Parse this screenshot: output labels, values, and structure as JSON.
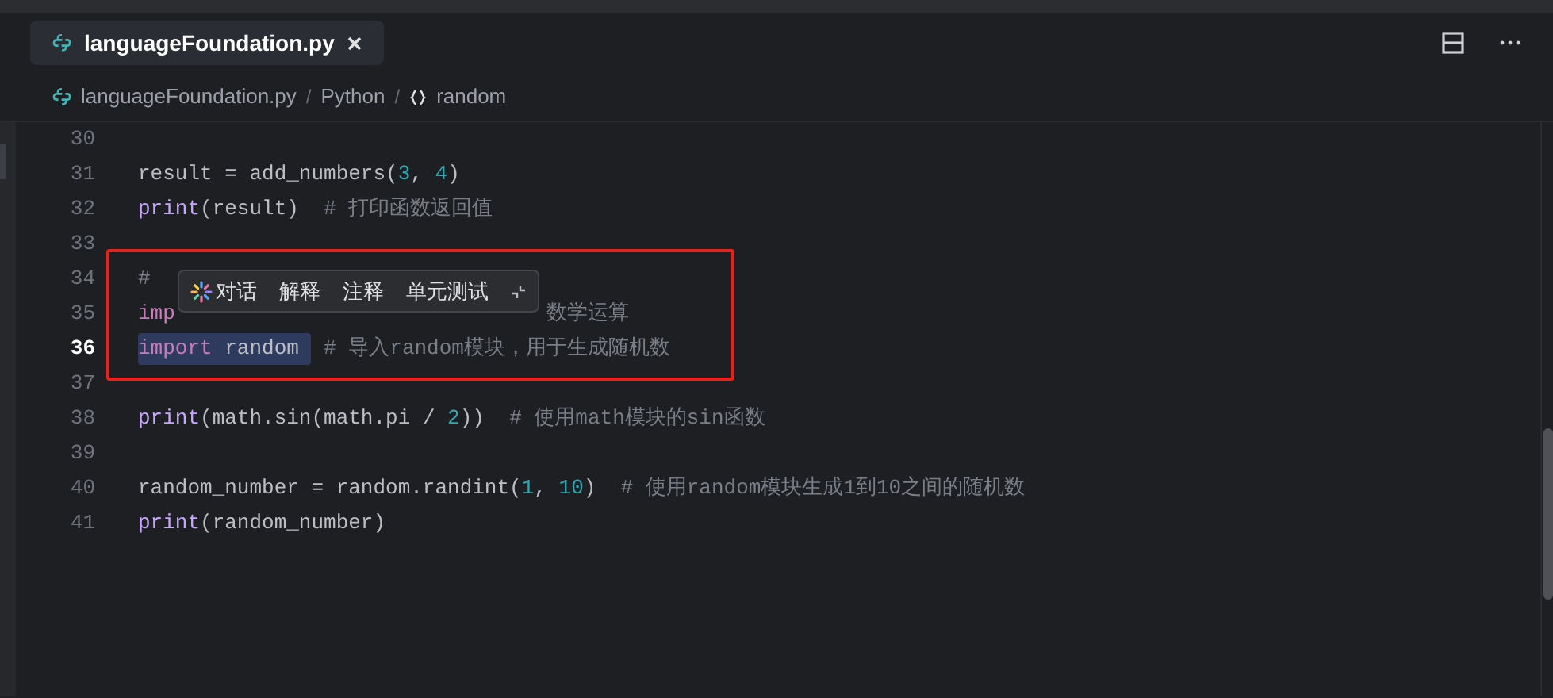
{
  "tabs": [
    {
      "label": "languageFoundation.py",
      "selected": true
    }
  ],
  "breadcrumb": [
    {
      "label": "languageFoundation.py",
      "kind": "file"
    },
    {
      "label": "/",
      "kind": "separator"
    },
    {
      "label": "Python",
      "kind": "plain"
    },
    {
      "label": "/",
      "kind": "separator"
    },
    {
      "label": "random",
      "kind": "symbol"
    }
  ],
  "lines": [
    {
      "number": "30",
      "current": false
    },
    {
      "number": "31",
      "current": false,
      "tokens": [
        {
          "text": "result = add_numbers(",
          "kind": "plain"
        },
        {
          "text": "3",
          "kind": "number"
        },
        {
          "text": ", ",
          "kind": "plain"
        },
        {
          "text": "4",
          "kind": "number"
        },
        {
          "text": ")",
          "kind": "plain"
        }
      ]
    },
    {
      "number": "32",
      "current": false,
      "tokens": [
        {
          "text": "print",
          "kind": "builtin"
        },
        {
          "text": "(result)  ",
          "kind": "plain"
        },
        {
          "text": "# 打印函数返回值",
          "kind": "comment"
        }
      ]
    },
    {
      "number": "33",
      "current": false
    },
    {
      "number": "34",
      "current": false,
      "tokens": [
        {
          "text": "#",
          "kind": "comment"
        }
      ]
    },
    {
      "number": "35",
      "current": false,
      "partly_covered": true,
      "tokens": [
        {
          "text": "imp",
          "kind": "keyword"
        },
        {
          "text": "数学运算",
          "kind": "comment"
        }
      ]
    },
    {
      "number": "36",
      "current": true,
      "tokens": [
        {
          "text": "import",
          "kind": "keyword",
          "selected": true
        },
        {
          "text": " random ",
          "kind": "plain",
          "selected": true
        },
        {
          "text": " # 导入random模块，用于生成随机数",
          "kind": "comment",
          "selected": false
        }
      ]
    },
    {
      "number": "37",
      "current": false
    },
    {
      "number": "38",
      "current": false,
      "tokens": [
        {
          "text": "print",
          "kind": "builtin"
        },
        {
          "text": "(math.sin(math.pi / ",
          "kind": "plain"
        },
        {
          "text": "2",
          "kind": "number"
        },
        {
          "text": "))  ",
          "kind": "plain"
        },
        {
          "text": "# 使用math模块的sin函数",
          "kind": "comment"
        }
      ]
    },
    {
      "number": "39",
      "current": false
    },
    {
      "number": "40",
      "current": false,
      "tokens": [
        {
          "text": "random_number = random.randint(",
          "kind": "plain"
        },
        {
          "text": "1",
          "kind": "number"
        },
        {
          "text": ", ",
          "kind": "plain"
        },
        {
          "text": "10",
          "kind": "number"
        },
        {
          "text": ")  ",
          "kind": "plain"
        },
        {
          "text": "# 使用random模块生成1到10之间的随机数",
          "kind": "comment"
        }
      ]
    },
    {
      "number": "41",
      "current": false,
      "tokens": [
        {
          "text": "print",
          "kind": "builtin"
        },
        {
          "text": "(random_number)",
          "kind": "plain"
        }
      ]
    }
  ],
  "popup": {
    "actions": [
      "对话",
      "解释",
      "注释",
      "单元测试"
    ]
  }
}
